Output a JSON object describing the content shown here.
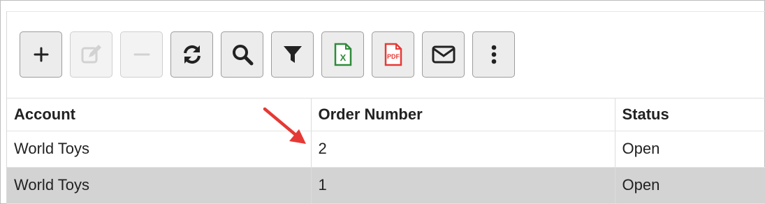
{
  "toolbar": {
    "buttons": [
      {
        "name": "add-button",
        "icon": "plus-icon",
        "enabled": true
      },
      {
        "name": "edit-button",
        "icon": "edit-icon",
        "enabled": false
      },
      {
        "name": "delete-button",
        "icon": "minus-icon",
        "enabled": false
      },
      {
        "name": "refresh-button",
        "icon": "refresh-icon",
        "enabled": true
      },
      {
        "name": "search-button",
        "icon": "search-icon",
        "enabled": true
      },
      {
        "name": "filter-button",
        "icon": "filter-icon",
        "enabled": true
      },
      {
        "name": "export-excel-button",
        "icon": "excel-file-icon",
        "enabled": true
      },
      {
        "name": "export-pdf-button",
        "icon": "pdf-file-icon",
        "enabled": true
      },
      {
        "name": "email-button",
        "icon": "envelope-icon",
        "enabled": true
      },
      {
        "name": "more-button",
        "icon": "vertical-dots-icon",
        "enabled": true
      }
    ],
    "pdf_label": "PDF",
    "excel_label": "X"
  },
  "colors": {
    "excel_green": "#2e8b3a",
    "pdf_red": "#e53935",
    "arrow_red": "#e53935",
    "alt_row": "#d3d3d3"
  },
  "grid": {
    "columns": [
      "Account",
      "Order Number",
      "Status"
    ],
    "rows": [
      [
        "World Toys",
        "2",
        "Open"
      ],
      [
        "World Toys",
        "1",
        "Open"
      ]
    ]
  }
}
